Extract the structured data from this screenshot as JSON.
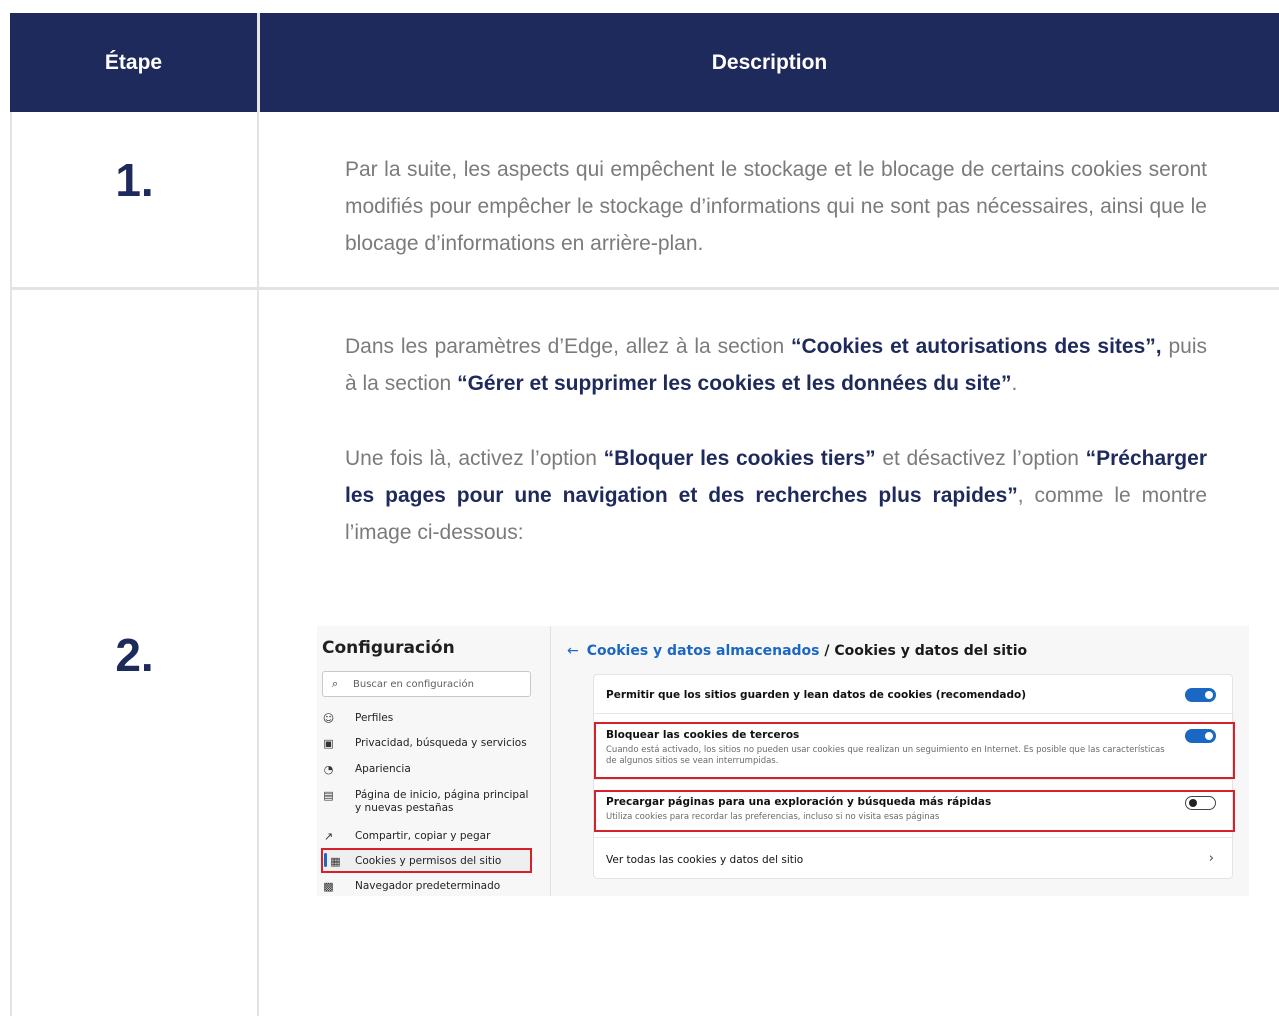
{
  "table": {
    "header_step": "Étape",
    "header_description": "Description"
  },
  "rows": [
    {
      "step": "1.",
      "text": "Par la suite, les aspects qui empêchent le stockage et le blocage de certains cookies seront modifiés pour empêcher le stockage d’informations qui ne sont pas nécessaires, ainsi que le blocage d’informations en arrière-plan."
    },
    {
      "step": "2.",
      "p1_a": "Dans les paramètres d’Edge, allez à la section ",
      "p1_b": "“Cookies et autorisations des sites”,",
      "p1_c": " puis à la section ",
      "p1_d": "“Gérer et supprimer les cookies et les données du site”",
      "p1_e": ".",
      "p2_a": "Une fois là, activez l’option ",
      "p2_b": "“Bloquer les cookies tiers”",
      "p2_c": " et désactivez l’option ",
      "p2_d": "“Précharger les pages pour une navigation et des recherches plus rapides”",
      "p2_e": ", comme le montre l’image ci-dessous:"
    }
  ],
  "screenshot": {
    "sidebar": {
      "title": "Configuración",
      "search_placeholder": "Buscar en configuración",
      "items": [
        {
          "icon": "profile-icon",
          "label": "Perfiles"
        },
        {
          "icon": "lock-icon",
          "label": "Privacidad, búsqueda y servicios"
        },
        {
          "icon": "appearance-icon",
          "label": "Apariencia"
        },
        {
          "icon": "home-page-icon",
          "label": "Página de inicio, página principal y nuevas pestañas"
        },
        {
          "icon": "share-icon",
          "label": "Compartir, copiar y pegar"
        },
        {
          "icon": "cookies-site-icon",
          "label": "Cookies y permisos del sitio"
        },
        {
          "icon": "default-browser-icon",
          "label": "Navegador predeterminado"
        }
      ]
    },
    "main": {
      "breadcrumb_link": "Cookies y datos almacenados",
      "breadcrumb_sep": " / ",
      "breadcrumb_current": "Cookies y datos del sitio",
      "settings": [
        {
          "title": "Permitir que los sitios guarden y lean datos de cookies (recomendado)",
          "toggle": "on"
        },
        {
          "title": "Bloquear las cookies de terceros",
          "subtitle": "Cuando está activado, los sitios no pueden usar cookies que realizan un seguimiento en Internet. Es posible que las características de algunos sitios se vean interrumpidas.",
          "toggle": "on"
        },
        {
          "title": "Precargar páginas para una exploración y búsqueda más rápidas",
          "subtitle": "Utiliza cookies para recordar las preferencias, incluso si no visita esas páginas",
          "toggle": "off"
        },
        {
          "title": "Ver todas las cookies y datos del sitio",
          "chevron": "chevron-right-icon"
        }
      ]
    }
  },
  "colors": {
    "header_bg": "#1f2a5c",
    "accent_text": "#1f2a5c",
    "highlight_red": "#d6202a",
    "toggle_blue": "#1a67c4"
  }
}
